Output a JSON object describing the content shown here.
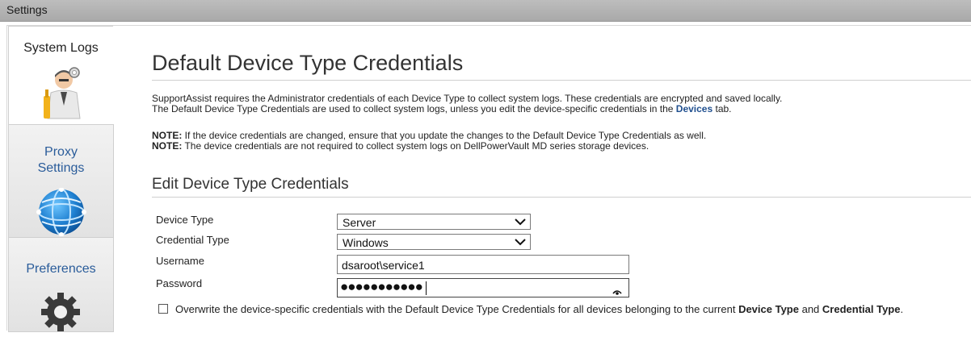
{
  "window": {
    "title": "Settings"
  },
  "sidebar": {
    "items": [
      {
        "label": "System Logs",
        "icon": "technician-icon",
        "active": true
      },
      {
        "label_line1": "Proxy",
        "label_line2": "Settings",
        "icon": "globe-network-icon",
        "active": false
      },
      {
        "label": "Preferences",
        "icon": "gear-icon",
        "active": false
      }
    ]
  },
  "main": {
    "title": "Default Device Type Credentials",
    "intro_line1": "SupportAssist requires the Administrator credentials of each Device Type to collect system logs. These credentials are encrypted and saved locally.",
    "intro_line2_before": "The Default Device Type Credentials are used to collect system logs, unless you edit the device-specific credentials in the ",
    "intro_line2_link": "Devices",
    "intro_line2_after": " tab.",
    "note1_label": "NOTE:",
    "note1_text": " If the device credentials are changed, ensure that you update the changes to the Default Device Type Credentials as well.",
    "note2_label": "NOTE:",
    "note2_text": " The device credentials are not required to collect system logs on DellPowerVault MD series storage devices.",
    "section_title": "Edit Device Type Credentials"
  },
  "form": {
    "device_type": {
      "label": "Device Type",
      "value": "Server"
    },
    "credential_type": {
      "label": "Credential Type",
      "value": "Windows"
    },
    "username": {
      "label": "Username",
      "value": "dsaroot\\service1"
    },
    "password": {
      "label": "Password",
      "masked_value": "●●●●●●●●●●●",
      "reveal_icon": "eye-icon"
    },
    "overwrite": {
      "checked": false,
      "text_before": "Overwrite the device-specific credentials with the Default Device Type Credentials for all devices belonging to the current ",
      "bold1": "Device Type",
      "text_mid": " and ",
      "bold2": "Credential Type",
      "text_after": "."
    }
  },
  "colors": {
    "link": "#1f4f8f",
    "sidebar_inactive_label": "#2a5c9a",
    "titlebar": "#b3b3b3"
  }
}
